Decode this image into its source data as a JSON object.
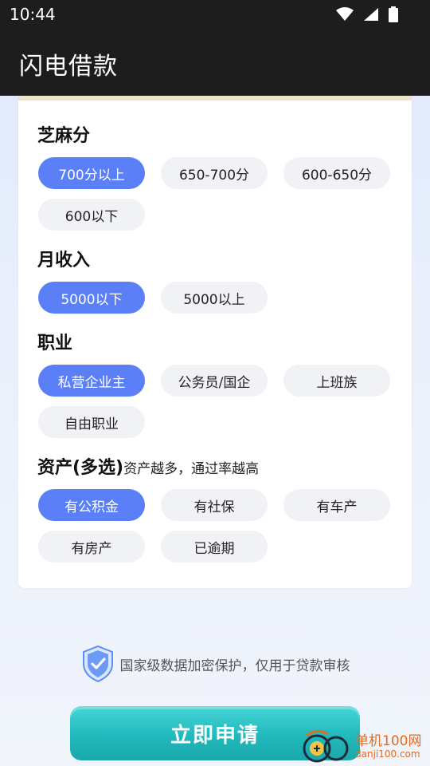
{
  "status": {
    "time": "10:44"
  },
  "app": {
    "title": "闪电借款"
  },
  "sections": {
    "credit": {
      "title": "芝麻分",
      "options": [
        "700分以上",
        "650-700分",
        "600-650分",
        "600以下"
      ],
      "selected": "700分以上"
    },
    "income": {
      "title": "月收入",
      "options": [
        "5000以下",
        "5000以上"
      ],
      "selected": "5000以下"
    },
    "job": {
      "title": "职业",
      "options": [
        "私营企业主",
        "公务员/国企",
        "上班族",
        "自由职业"
      ],
      "selected": "私营企业主"
    },
    "assets": {
      "title": "资产(多选)",
      "subtitle": "资产越多，通过率越高",
      "options": [
        "有公积金",
        "有社保",
        "有车产",
        "有房产",
        "已逾期"
      ],
      "selected": [
        "有公积金"
      ]
    }
  },
  "security": {
    "note": "国家级数据加密保护，仅用于贷款审核",
    "icon": "shield-check-icon"
  },
  "apply": {
    "label": "立即申请"
  },
  "watermark": {
    "line1": "单机100网",
    "line2": "danji100.com"
  },
  "colors": {
    "accent": "#5b7ff7",
    "button": "#21b9bc",
    "topbar": "#1d1d1d"
  }
}
